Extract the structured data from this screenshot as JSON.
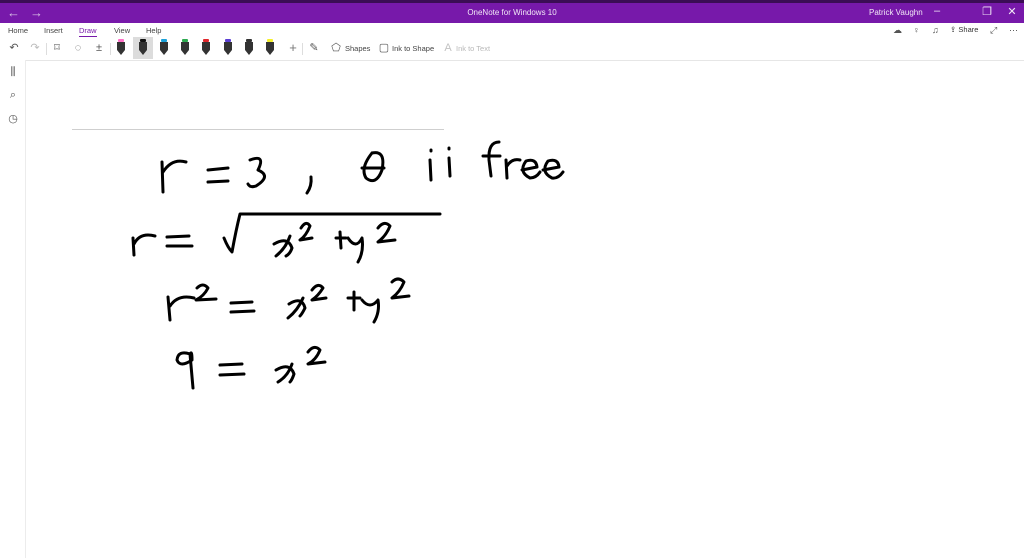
{
  "window": {
    "title": "OneNote for Windows 10",
    "user": "Patrick Vaughn",
    "share_label": "Share"
  },
  "tabs": [
    {
      "label": "Home"
    },
    {
      "label": "Insert"
    },
    {
      "label": "Draw"
    },
    {
      "label": "View"
    },
    {
      "label": "Help"
    }
  ],
  "ribbon": {
    "shapes_label": "Shapes",
    "ink_to_shape_label": "Ink to Shape",
    "ink_to_text_label": "Ink to Text"
  },
  "pens": [
    {
      "cap": "#ff6ec7",
      "name": "pink-highlighter-pen"
    },
    {
      "cap": "#111111",
      "name": "black-pen-selected"
    },
    {
      "cap": "#1aa0d8",
      "name": "blue-pen"
    },
    {
      "cap": "#2da94f",
      "name": "green-pen"
    },
    {
      "cap": "#e0262b",
      "name": "red-pen"
    },
    {
      "cap": "#5b3fd3",
      "name": "purple-pen"
    },
    {
      "cap": "#333333",
      "name": "dark-pen"
    },
    {
      "cap": "#f5ef2b",
      "name": "yellow-highlighter"
    }
  ],
  "icons": {
    "back": "arrow-left-icon",
    "forward": "arrow-right-icon",
    "undo": "undo-icon",
    "redo": "redo-icon"
  }
}
